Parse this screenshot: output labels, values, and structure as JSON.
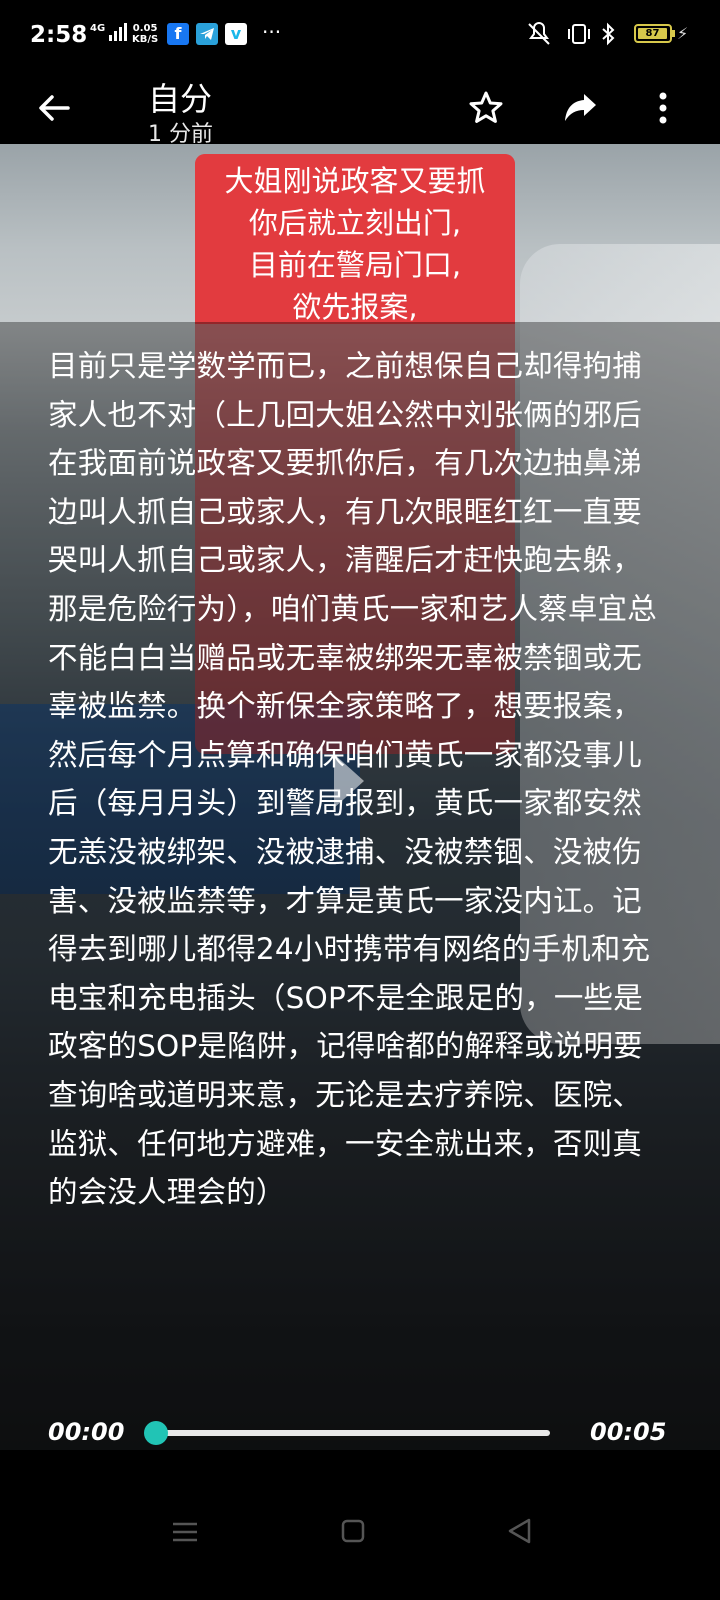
{
  "status_bar": {
    "time": "2:58",
    "network": "4G",
    "speed_value": "0.05",
    "speed_unit": "KB/S",
    "app_icons": [
      "facebook-icon",
      "telegram-icon",
      "vimeo-icon"
    ],
    "more": "···",
    "battery": "87"
  },
  "header": {
    "title": "自分",
    "subtitle": "1 分前"
  },
  "video": {
    "note_lines": [
      "大姐刚说政客又要抓",
      "你后就立刻出门,",
      "目前在警局门口,",
      "欲先报案,"
    ],
    "caption": "目前只是学数学而已，之前想保自己却得拘捕家人也不对（上几回大姐公然中刘张俩的邪后在我面前说政客又要抓你后，有几次边抽鼻涕边叫人抓自己或家人，有几次眼眶红红一直要哭叫人抓自己或家人，清醒后才赶快跑去躲，那是危险行为），咱们黄氏一家和艺人蔡卓宜总不能白白当赠品或无辜被绑架无辜被禁锢或无辜被监禁。换个新保全家策略了，想要报案，然后每个月点算和确保咱们黄氏一家都没事儿后（每月月头）到警局报到，黄氏一家都安然无恙没被绑架、没被逮捕、没被禁锢、没被伤害、没被监禁等，才算是黄氏一家没内讧。记得去到哪儿都得24小时携带有网络的手机和充电宝和充电插头（SOP不是全跟足的，一些是政客的SOP是陷阱，记得啥都的解释或说明要查询啥或道明来意，无论是去疗养院、医院、监狱、任何地方避难，一安全就出来，否则真的会没人理会的）"
  },
  "player": {
    "current_time": "00:00",
    "duration": "00:05",
    "progress": 0
  },
  "colors": {
    "accent": "#21c4b5",
    "note_bg": "#e23b3f"
  }
}
